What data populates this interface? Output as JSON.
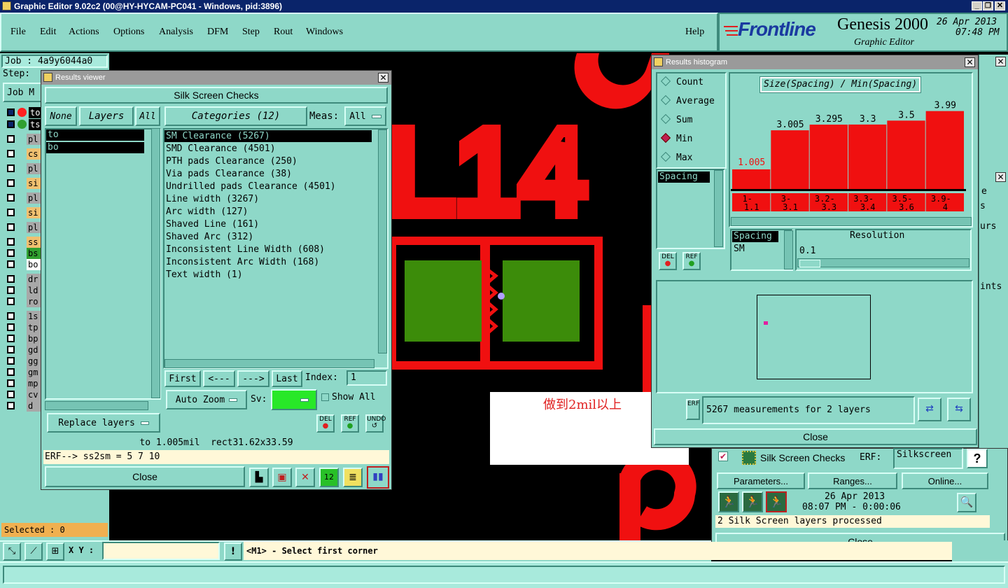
{
  "titlebar": {
    "title": "Graphic Editor 9.02c2 (00@HY-HYCAM-PC041 - Windows, pid:3896)"
  },
  "menu": [
    "File",
    "Edit",
    "Actions",
    "Options",
    "Analysis",
    "DFM",
    "Step",
    "Rout",
    "Windows"
  ],
  "menu_help": "Help",
  "brand": {
    "logo": "Frontline",
    "product": "Genesis 2000",
    "subtitle": "Graphic Editor",
    "date": "26 Apr 2013",
    "time": "07:48 PM"
  },
  "job": {
    "label": "Job : 4a9y6044a0",
    "step_label": "Step:",
    "job_matrix_label": "Job M"
  },
  "layers": [
    {
      "name": "to",
      "color": "#ff2020",
      "visible": true
    },
    {
      "name": "ts",
      "color": "#30a030",
      "visible": true
    },
    {
      "name": "pl",
      "color": "#a8a8a8"
    },
    {
      "name": "cs",
      "color": "#f0c070"
    },
    {
      "name": "pl",
      "color": "#a8a8a8"
    },
    {
      "name": "si",
      "color": "#f0c070"
    },
    {
      "name": "pl",
      "color": "#a8a8a8"
    },
    {
      "name": "si",
      "color": "#f0c070"
    },
    {
      "name": "pl",
      "color": "#a8a8a8"
    },
    {
      "name": "ss",
      "color": "#f0c070"
    },
    {
      "name": "bs",
      "color": "#30a030"
    },
    {
      "name": "bo",
      "color": "#ffffff"
    },
    {
      "name": "dr",
      "color": "#a8a8a8"
    },
    {
      "name": "ld",
      "color": "#a8a8a8"
    },
    {
      "name": "ro",
      "color": "#a8a8a8"
    },
    {
      "name": "1s",
      "color": "#a8a8a8"
    },
    {
      "name": "tp",
      "color": "#a8a8a8"
    },
    {
      "name": "bp",
      "color": "#a8a8a8"
    },
    {
      "name": "gd",
      "color": "#a8a8a8"
    },
    {
      "name": "gg",
      "color": "#a8a8a8"
    },
    {
      "name": "gm",
      "color": "#a8a8a8"
    },
    {
      "name": "mp",
      "color": "#a8a8a8"
    },
    {
      "name": "cv",
      "color": "#a8a8a8"
    },
    {
      "name": "d",
      "color": "#a8a8a8"
    }
  ],
  "selected": "Selected : 0",
  "results_viewer": {
    "title": "Results viewer",
    "header": "Silk Screen Checks",
    "none_btn": "None",
    "layers_btn": "Layers",
    "all_btn": "All",
    "categories_btn": "Categories (12)",
    "meas_label": "Meas:",
    "meas_value": "All",
    "layer_items": [
      "to",
      "bo"
    ],
    "categories": [
      "SM Clearance (5267)",
      "SMD Clearance (4501)",
      "PTH pads Clearance (250)",
      "Via pads Clearance (38)",
      "Undrilled pads Clearance (4501)",
      "Line width (3267)",
      "Arc width (127)",
      "Shaved Line (161)",
      "Shaved Arc (312)",
      "Inconsistent Line Width (608)",
      "Inconsistent Arc Width (168)",
      "Text width (1)"
    ],
    "first": "First",
    "prev": "<---",
    "next": "--->",
    "last": "Last",
    "index_label": "Index:",
    "index_value": "1",
    "auto_zoom": "Auto Zoom",
    "sv_label": "Sv:",
    "show_all": "Show All",
    "replace_layers": "Replace layers",
    "del": "DEL",
    "ref": "REF",
    "undo": "UNDO",
    "status": "to 1.005mil  rect31.62x33.59",
    "erf": "ERF--> ss2sm = 5 7 10",
    "close": "Close"
  },
  "canvas": {
    "annotation": "做到2mil以上",
    "text_l14": "L14"
  },
  "histogram": {
    "title": "Results histogram",
    "radios": [
      "Count",
      "Average",
      "Sum",
      "Min",
      "Max"
    ],
    "selected_radio": "Min",
    "chart_title": "Size(Spacing) / Min(Spacing)",
    "list_items": [
      "Spacing"
    ],
    "list2_items": [
      "Spacing",
      "SM"
    ],
    "resolution_label": "Resolution",
    "resolution_value": "0.1",
    "del": "DEL",
    "ref": "REF",
    "measurements": "5267 measurements for 2 layers",
    "close": "Close"
  },
  "chart_data": {
    "type": "bar",
    "title": "Size(Spacing) / Min(Spacing)",
    "categories": [
      "1-\n1.1",
      "3-\n3.1",
      "3.2-\n3.3",
      "3.3-\n3.4",
      "3.5-\n3.6",
      "3.9-\n4"
    ],
    "values": [
      1.005,
      3.005,
      3.295,
      3.3,
      3.5,
      3.99
    ],
    "value_labels": [
      "1.005",
      "3.005",
      "3.295",
      "3.3",
      "3.5",
      "3.99"
    ],
    "ylim": [
      0,
      4.3
    ],
    "bar_color": "#f01010",
    "highlight_label_color": "#f01010"
  },
  "checklist": {
    "name": "Silk Screen Checks",
    "erf_label": "ERF:",
    "erf_value": "Silkscreen",
    "parameters": "Parameters...",
    "ranges": "Ranges...",
    "online": "Online...",
    "date": "26 Apr 2013",
    "time": "08:07 PM - 0:00:06",
    "status": "2 Silk Screen layers processed",
    "close": "Close",
    "side_labels": [
      "s",
      "urs",
      "ints",
      "e"
    ]
  },
  "bottom": {
    "xy_label": "X Y :",
    "prompt": "<M1> - Select first corner"
  }
}
